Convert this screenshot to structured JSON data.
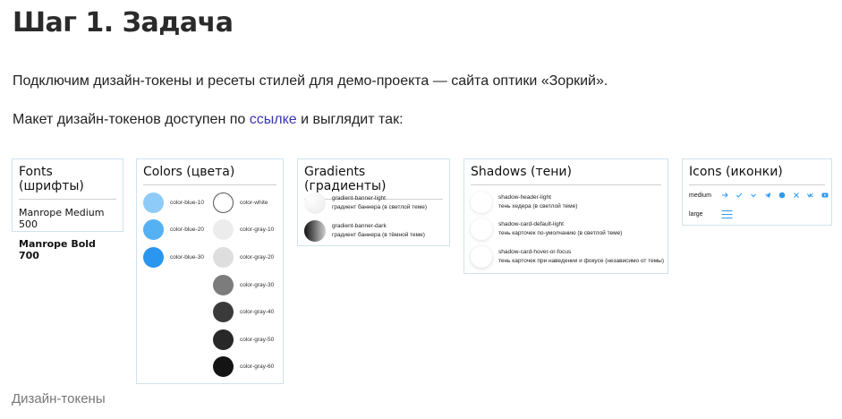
{
  "page": {
    "title": "Шаг 1. Задача",
    "intro": "Подключим дизайн-токены и ресеты стилей для демо-проекта — сайта оптики «Зоркий».",
    "layout_text_before": "Макет дизайн-токенов доступен по ",
    "layout_link": "ссылке",
    "layout_text_after": " и выглядит так:",
    "caption": "Дизайн-токены"
  },
  "fonts": {
    "title": "Fonts (шрифты)",
    "items": [
      "Manrope Medium 500",
      "Manrope Bold 700"
    ]
  },
  "colors": {
    "title": "Colors (цвета)",
    "left": [
      {
        "name": "color-blue-10",
        "hex": "#8fcbf8"
      },
      {
        "name": "color-blue-20",
        "hex": "#56b1f3"
      },
      {
        "name": "color-blue-30",
        "hex": "#2a96ef"
      }
    ],
    "right": [
      {
        "name": "color-white",
        "hex": "#ffffff"
      },
      {
        "name": "color-gray-10",
        "hex": "#ececec"
      },
      {
        "name": "color-gray-20",
        "hex": "#dedede"
      },
      {
        "name": "color-gray-30",
        "hex": "#7c7c7c"
      },
      {
        "name": "color-gray-40",
        "hex": "#3a3a3a"
      },
      {
        "name": "color-gray-50",
        "hex": "#282828"
      },
      {
        "name": "color-gray-60",
        "hex": "#141414"
      }
    ]
  },
  "gradients": {
    "title": "Gradients (градиенты)",
    "items": [
      {
        "name": "gradient-banner-light",
        "desc": "градиент баннера (в светлой теме)"
      },
      {
        "name": "gradient-banner-dark",
        "desc": "градиент баннера (в тёмной теме)"
      }
    ]
  },
  "shadows": {
    "title": "Shadows (тени)",
    "items": [
      {
        "name": "shadow-header-light",
        "desc": "тень хедера (в светлой теме)"
      },
      {
        "name": "shadow-card-default-light",
        "desc": "тень карточек по-умолчанию (в светлой теме)"
      },
      {
        "name": "shadow-card-hover-or-focus",
        "desc": "тень карточек при наведении и фокусе (независимо от темы)"
      }
    ]
  },
  "icons": {
    "title": "Icons (иконки)",
    "medium_label": "medium",
    "large_label": "large",
    "medium_icons": [
      "arrow-right-icon",
      "check-icon",
      "chevron-down-icon",
      "telegram-icon",
      "circle-icon",
      "close-icon",
      "vk-icon",
      "youtube-icon"
    ],
    "large_icons": [
      "menu-icon"
    ],
    "accent": "#2e9bf0"
  }
}
